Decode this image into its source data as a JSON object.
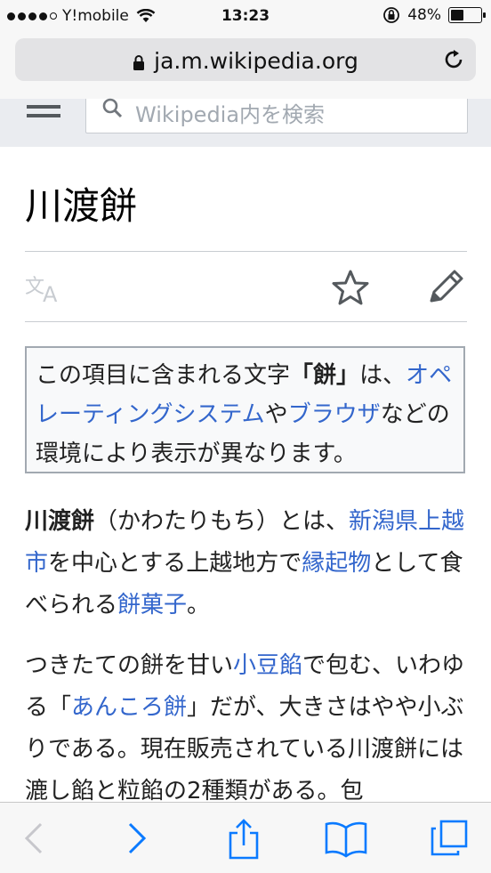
{
  "status": {
    "carrier": "Y!mobile",
    "time": "13:23",
    "battery": "48%",
    "battery_level": 0.48
  },
  "browser": {
    "url": "ja.m.wikipedia.org"
  },
  "wiki": {
    "search_placeholder": "Wikipedia内を検索"
  },
  "article": {
    "title": "川渡餅",
    "notice": {
      "t1": "この項目に含まれる文字",
      "t2": "「",
      "t3": "餅",
      "t4": "」",
      "t5": "は、",
      "link1": "オペレーティングシステム",
      "t6": "や",
      "link2": "ブラウザ",
      "t7": "などの環境により表示が異なります。"
    },
    "p1": {
      "bold": "川渡餅",
      "t1": "（かわたりもち）とは、",
      "link1": "新潟県",
      "link2": "上越市",
      "t2": "を中心とする上越地方で",
      "link3": "縁起物",
      "t3": "として食べられる",
      "link4": "餅菓子",
      "t4": "。"
    },
    "p2": {
      "t1": "つきたての餅を甘い",
      "link1": "小豆餡",
      "t2": "で包む、いわゆる「",
      "link2": "あんころ餅",
      "t3": "」だが、大きさはやや小ぶりである。現在販売されている川渡餅には漉し餡と粒餡の2種類がある。包"
    }
  },
  "icons": {
    "lock": "lock-icon",
    "reload": "reload-icon",
    "menu": "menu-icon",
    "search": "search-icon",
    "translate": "translate-icon",
    "star": "star-icon",
    "edit": "pencil-icon",
    "back": "back-icon",
    "forward": "forward-icon",
    "share": "share-icon",
    "bookmarks": "bookmarks-icon",
    "tabs": "tabs-icon"
  },
  "colors": {
    "link": "#3366cc",
    "ios_blue": "#0a7aff"
  }
}
